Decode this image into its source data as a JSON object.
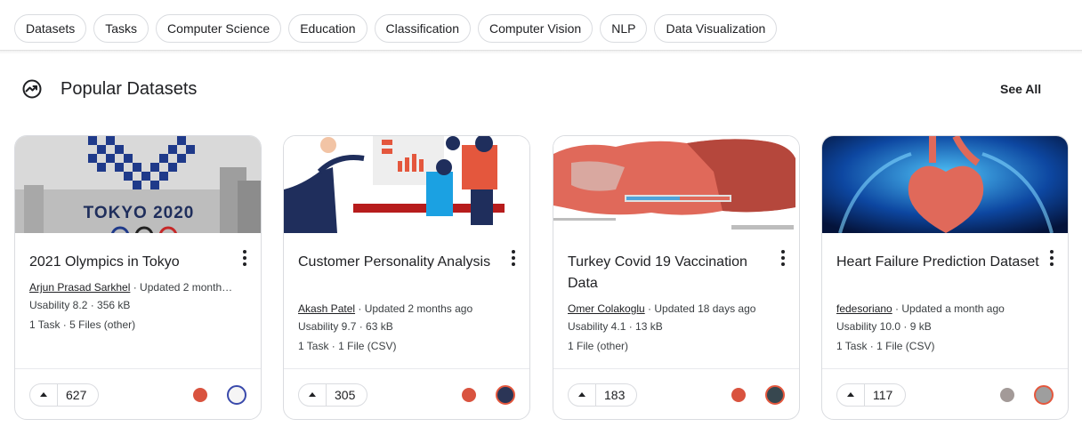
{
  "tags": [
    "Datasets",
    "Tasks",
    "Computer Science",
    "Education",
    "Classification",
    "Computer Vision",
    "NLP",
    "Data Visualization"
  ],
  "section": {
    "icon": "trending-up-icon",
    "title": "Popular Datasets",
    "see_all": "See All"
  },
  "cards": [
    {
      "thumb": "tokyo-2020-image",
      "thumb_text": "TOKYO 2020",
      "title": "2021 Olympics in Tokyo",
      "author": "Arjun Prasad Sarkhel",
      "updated": " · Updated 2 month…",
      "usage": "Usability 8.2 · 356 kB",
      "files": "1 Task · 5 Files (other)",
      "votes": "627",
      "medal_color": "#d9533f"
    },
    {
      "thumb": "business-meeting-illustration",
      "title": "Customer Personality Analysis",
      "author": "Akash Patel",
      "updated": " · Updated 2 months ago",
      "usage": "Usability 9.7 · 63 kB",
      "files": "1 Task · 1 File (CSV)",
      "votes": "305",
      "medal_color": "#d9533f"
    },
    {
      "thumb": "turkey-vaccination-map",
      "title": "Turkey Covid 19 Vaccination Data",
      "author": "Omer Colakoglu",
      "updated": " · Updated 18 days ago",
      "usage": "Usability 4.1 · 13 kB",
      "files": "1 File (other)",
      "votes": "183",
      "medal_color": "#d9533f"
    },
    {
      "thumb": "heart-xray-image",
      "title": "Heart Failure Prediction Dataset",
      "author": "fedesoriano",
      "updated": " · Updated a month ago",
      "usage": "Usability 10.0 · 9 kB",
      "files": "1 Task · 1 File (CSV)",
      "votes": "117",
      "medal_color": "#a39a98"
    }
  ],
  "colors": {
    "accent": "#202124",
    "medal_gold": "#d9533f",
    "medal_silver": "#a39a98",
    "border": "#dadce0"
  }
}
